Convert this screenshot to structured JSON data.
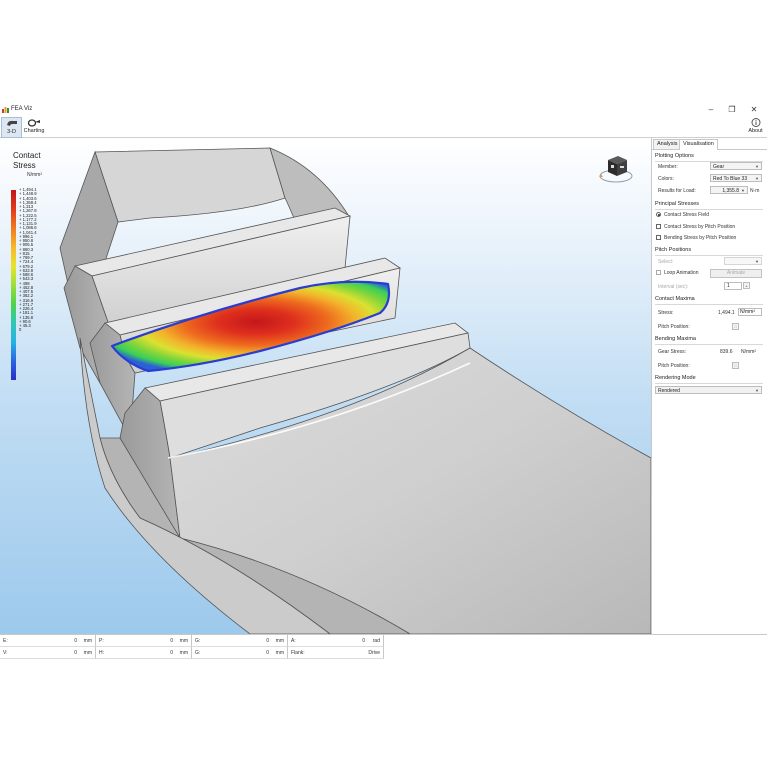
{
  "window": {
    "title": "FEA Viz",
    "minimize": "–",
    "maximize": "❐",
    "close": "✕"
  },
  "toolbar": {
    "view3d_label": "3-D",
    "charting_label": "Charting",
    "about_label": "About"
  },
  "legend": {
    "title": "Contact Stress",
    "unit": "N/mm²",
    "labels": [
      "+ 1,494.1",
      "+ 1,448.9",
      "+ 1,403.6",
      "+ 1,358.4",
      "+ 1,313",
      "+ 1,267.8",
      "+ 1,222.5",
      "+ 1,177.2",
      "+ 1,131.9",
      "+ 1,086.6",
      "+ 1,041.4",
      "+ 996.1",
      "+ 950.8",
      "+ 905.5",
      "+ 860.3",
      "+ 815",
      "+ 769.7",
      "+ 724.4",
      "+ 679.2",
      "+ 633.9",
      "+ 588.6",
      "+ 543.3",
      "+ 498",
      "+ 452.8",
      "+ 407.5",
      "+ 362.2",
      "+ 316.9",
      "+ 271.7",
      "+ 226.4",
      "+ 181.1",
      "+ 135.8",
      "+ 90.6",
      "+ 45.3",
      "0"
    ]
  },
  "panel": {
    "tabs": [
      "Analysis",
      "Visualisation"
    ],
    "plotting": {
      "heading": "Plotting Options",
      "member_label": "Member:",
      "member_value": "Gear",
      "colors_label": "Colors:",
      "colors_value": "Red To Blue 33",
      "load_label": "Results for Load:",
      "load_value": "1,355.8",
      "load_unit": "N·m"
    },
    "principal": {
      "heading": "Principal Stresses",
      "opt1": "Contact Stress Field",
      "opt2": "Contact Stress by Pitch Position",
      "opt3": "Bending Stress by Pitch Position"
    },
    "pitch": {
      "heading": "Pitch Positions",
      "select_label": "Select:",
      "loop_label": "Loop Animation",
      "animate_label": "Animate",
      "interval_label": "Interval (sec):",
      "interval_value": "1"
    },
    "contact": {
      "heading": "Contact Maxima",
      "stress_label": "Stress:",
      "stress_value": "1,494.1",
      "stress_unit": "N/mm²",
      "pitch_label": "Pitch Position:"
    },
    "bending": {
      "heading": "Bending Maxima",
      "stress_label": "Gear Stress:",
      "stress_value": "839.6",
      "stress_unit": "N/mm²",
      "pitch_label": "Pitch Position:"
    },
    "rendering": {
      "heading": "Rendering Mode",
      "value": "Rendered"
    }
  },
  "status": {
    "row1": [
      {
        "key": "E:",
        "value": "0",
        "unit": "mm"
      },
      {
        "key": "P:",
        "value": "0",
        "unit": "mm"
      },
      {
        "key": "G:",
        "value": "0",
        "unit": "mm"
      },
      {
        "key": "A:",
        "value": "0",
        "unit": "rad"
      }
    ],
    "row2": [
      {
        "key": "V:",
        "value": "0",
        "unit": "mm"
      },
      {
        "key": "H:",
        "value": "0",
        "unit": "mm"
      },
      {
        "key": "G:",
        "value": "0",
        "unit": "mm"
      },
      {
        "key": "Flank:",
        "value": "Drive",
        "unit": ""
      }
    ]
  }
}
